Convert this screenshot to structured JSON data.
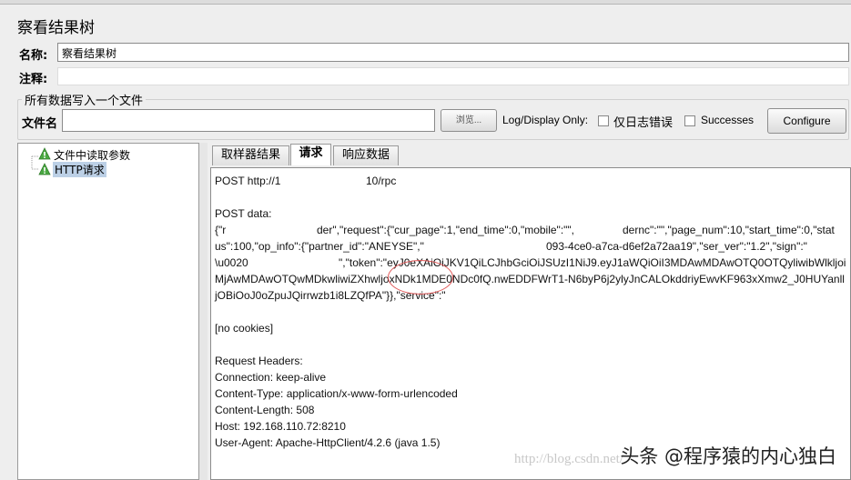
{
  "window": {
    "title": "察看结果树"
  },
  "form": {
    "name_label": "名称:",
    "name_value": "察看结果树",
    "comment_label": "注释:",
    "comment_value": ""
  },
  "file_section": {
    "title": "所有数据写入一个文件",
    "file_label": "文件名",
    "file_value": "",
    "browse_label": "浏览...",
    "log_display_label": "Log/Display Only:",
    "errors_only_label": "仅日志错误",
    "successes_label": "Successes",
    "configure_label": "Configure"
  },
  "tree": {
    "items": [
      {
        "label": "文件中读取参数",
        "icon": "green-triangle-warning-icon",
        "selected": false
      },
      {
        "label": "HTTP请求",
        "icon": "green-triangle-warning-icon",
        "selected": true
      }
    ]
  },
  "tabs": [
    {
      "label": "取样器结果",
      "active": false
    },
    {
      "label": "请求",
      "active": true
    },
    {
      "label": "响应数据",
      "active": false
    }
  ],
  "request": {
    "lines": [
      "POST http://1",
      "10/rpc",
      "",
      "POST data:",
      "{\"r",
      "der\",\"request\":{\"cur_page\":1,\"end_time\":0,\"mobile\":\"\",",
      "dernc\":\"\",\"page_num\":10,\"start_time\":0,\"stat",
      "us\":100,\"op_info\":{\"partner_id\":\"ANE",
      "YSE\",\"",
      "093-4ce0-a7ca-d6ef2a72aa19\",\"ser_ver\":\"1.2\",\"sign\":\"",
      "\\u0020",
      "\",\"token\":\"eyJ0eXAiOiJKV1QiLCJhbGciOiJSUzI1NiJ9.eyJ1aWQiOiI3MDAwMDAwOTQ0OTQyliwibWlkljoi",
      "MjAwMDAwOTQwMDkwliwiZXhwljoxNDk1MDE0NDc0fQ.nwEDDFWrT1-N6byP6j2ylyJnCALOkddriyEwvKF963xXmw2_J0HUYanll",
      "jOBiOoJ0oZpuJQirrwzb1i8LZQfPA\"}},\"service\":\"",
      "",
      "[no cookies]",
      "",
      "Request Headers:",
      "Connection: keep-alive",
      "Content-Type: application/x-www-form-urlencoded",
      "Content-Length: 508",
      "Host: 192.168.110.72:8210",
      "User-Agent: Apache-HttpClient/4.2.6 (java 1.5)"
    ]
  },
  "overlay": {
    "watermark": "头条 @程序猿的内心独白",
    "faint_url": "http://blog.csdn.net/"
  }
}
